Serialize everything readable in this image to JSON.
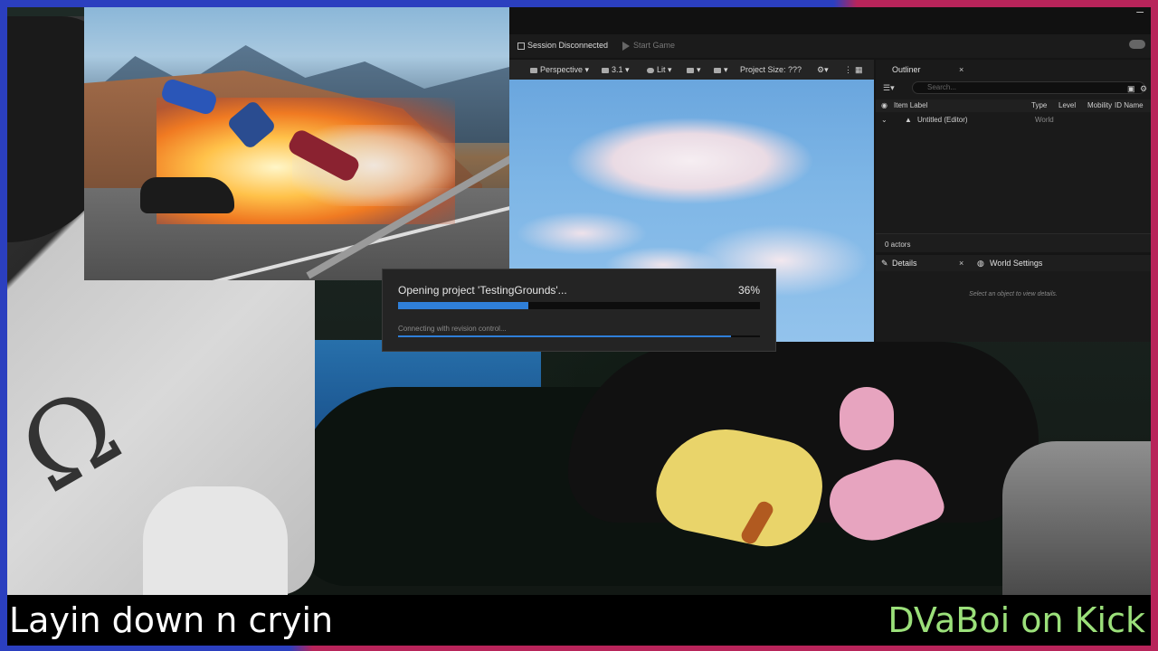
{
  "overlay": {
    "caption_left": "Layin down n cryin",
    "caption_right": "DVaBoi on Kick",
    "caption_right_color": "#9be07a",
    "frame_colors": [
      "#2b3fbf",
      "#b8245a"
    ]
  },
  "editor": {
    "toolbar": {
      "session_status": "Session Disconnected",
      "start_game": "Start Game"
    },
    "viewport_bar": {
      "perspective": "Perspective",
      "camera_speed": "3.1",
      "view_mode": "Lit",
      "project_size": "Project Size: ???"
    },
    "outliner": {
      "tab_label": "Outliner",
      "close": "×",
      "search_placeholder": "Search...",
      "columns": [
        "Item Label",
        "Type",
        "Level",
        "Mobility",
        "ID Name"
      ],
      "rows": [
        {
          "label": "Untitled (Editor)",
          "type": "World"
        }
      ],
      "actor_count": "0 actors"
    },
    "details": {
      "tab_label": "Details",
      "close": "×",
      "world_settings_tab": "World Settings",
      "hint": "Select an object to view details."
    }
  },
  "dialog": {
    "title": "Opening project 'TestingGrounds'...",
    "percent_text": "36%",
    "progress": 0.36,
    "subtitle": "Connecting with revision control...",
    "sub_progress": 0.92,
    "accent": "#2f7fd8"
  }
}
